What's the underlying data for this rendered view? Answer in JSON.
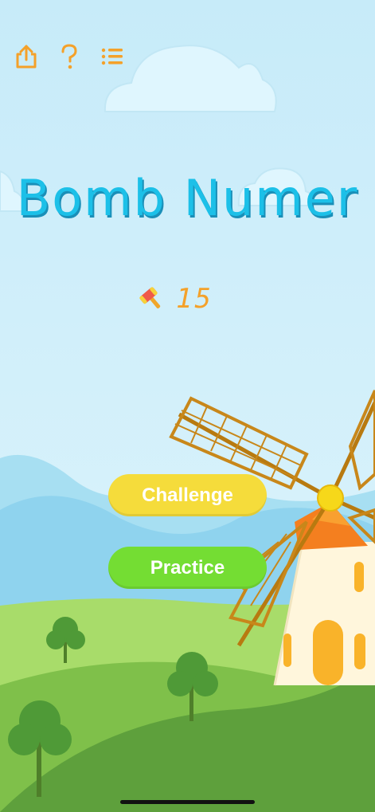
{
  "title": "Bomb Numer",
  "counter": {
    "icon": "hammer-icon",
    "value": "15"
  },
  "buttons": {
    "challenge": "Challenge",
    "practice": "Practice"
  },
  "toolbar": {
    "share_icon": "share-icon",
    "help_icon": "question-icon",
    "menu_icon": "list-icon"
  },
  "colors": {
    "sky": "#cdeefa",
    "title": "#1cc0e8",
    "accent_orange": "#f4a12a",
    "challenge_button": "#f5dc3b",
    "practice_button": "#74dd33",
    "grass_light": "#a8dc6a",
    "grass_dark": "#5ea03c"
  }
}
